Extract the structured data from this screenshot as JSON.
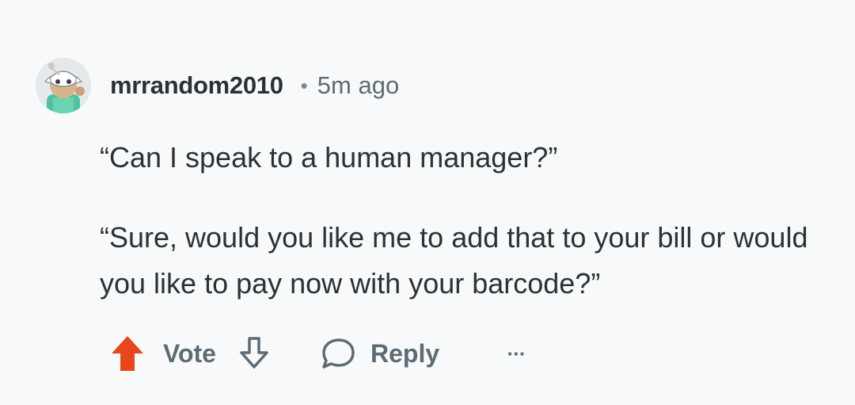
{
  "comment": {
    "username": "mrrandom2010",
    "separator": "•",
    "age": "5m ago",
    "paragraphs": [
      "“Can I speak to a human manager?”",
      "“Sure, would you like me to add that to your bill or would you like to pay now with your barcode?”"
    ]
  },
  "actions": {
    "upvote_icon": "upvote-arrow-icon",
    "vote_label": "Vote",
    "downvote_icon": "downvote-arrow-icon",
    "reply_icon": "speech-bubble-icon",
    "reply_label": "Reply",
    "more_label": "···"
  },
  "colors": {
    "background": "#f8f9fa",
    "text": "#2a3236",
    "muted": "#5c6c74",
    "upvote_active": "#e8471b"
  }
}
